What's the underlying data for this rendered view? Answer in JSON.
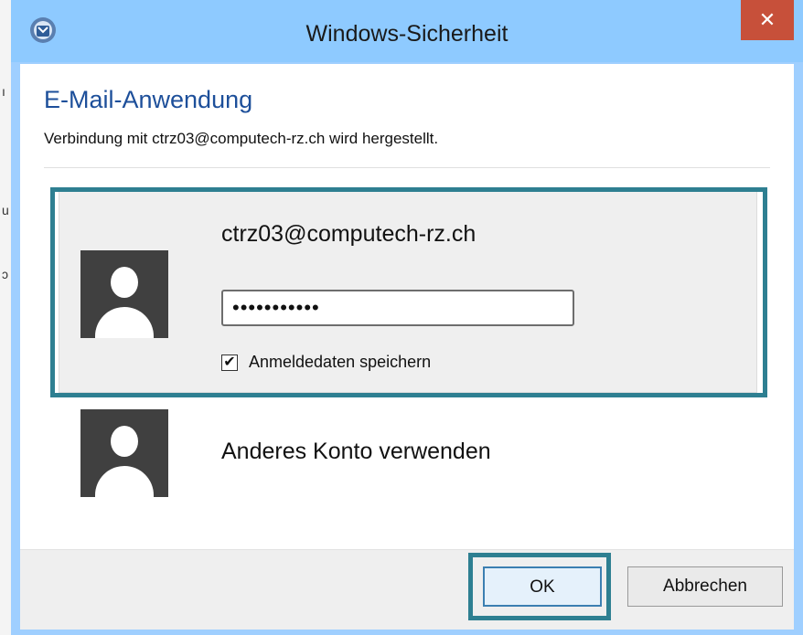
{
  "window": {
    "title": "Windows-Sicherheit",
    "close_label": "✕"
  },
  "header": {
    "app_name": "E-Mail-Anwendung",
    "subtitle": "Verbindung mit ctrz03@computech-rz.ch wird hergestellt."
  },
  "credential": {
    "username": "ctrz03@computech-rz.ch",
    "password_value": "•••••••••••",
    "remember_label": "Anmeldedaten speichern",
    "remember_checked": true,
    "check_glyph": "✔"
  },
  "other_account": {
    "label": "Anderes Konto verwenden"
  },
  "buttons": {
    "ok": "OK",
    "cancel": "Abbrechen"
  },
  "background": {
    "glyphs": [
      "ı",
      "u",
      "ɔ"
    ]
  },
  "colors": {
    "titlebar": "#8ecaff",
    "close_button": "#c7503a",
    "app_name": "#1d4f9a",
    "highlight": "#2e7f91",
    "avatar": "#404040"
  }
}
